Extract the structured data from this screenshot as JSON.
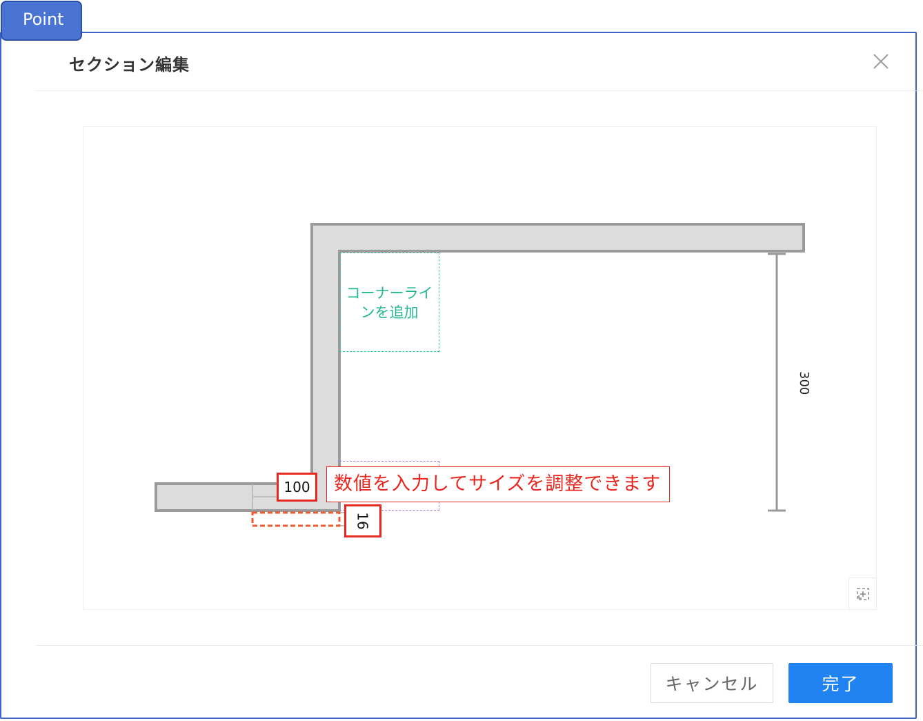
{
  "badge": {
    "label": "Point"
  },
  "dialog": {
    "title": "セクション編集",
    "close_icon": "close-icon"
  },
  "canvas": {
    "corner_line_label": "コーナーライ\nンを追加",
    "height_value": "300",
    "width_value": "100",
    "depth_value": "16",
    "callout_text": "数値を入力してサイズを調整できます",
    "fit_icon": "fit-view-icon"
  },
  "footer": {
    "cancel_label": "キャンセル",
    "done_label": "完了"
  },
  "colors": {
    "accent": "#2183f2",
    "annotation_red": "#e8271f",
    "badge_blue": "#4a74d4",
    "corner_line_green": "#24b791",
    "wall_fill": "#dcdcdc",
    "wall_stroke": "#9a9a9a"
  }
}
